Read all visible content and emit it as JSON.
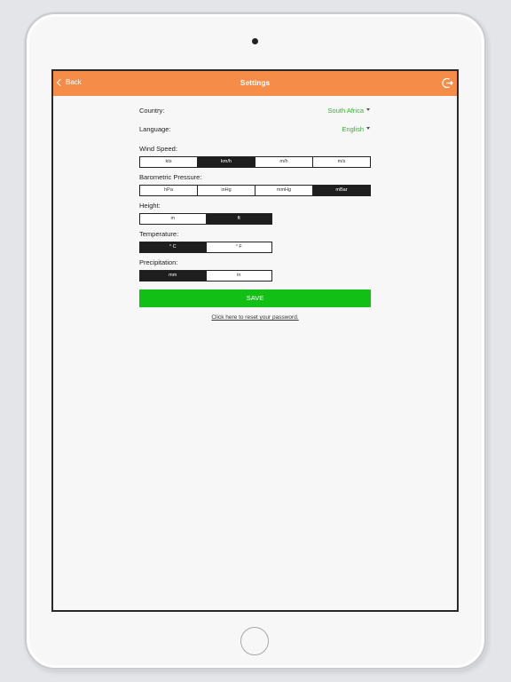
{
  "navbar": {
    "back_label": "Back",
    "title": "Settings",
    "logout_icon": "logout-icon"
  },
  "settings": {
    "country": {
      "label": "Country:",
      "value": "South Africa"
    },
    "language": {
      "label": "Language:",
      "value": "English"
    },
    "wind_speed": {
      "label": "Wind Speed:",
      "options": [
        "kts",
        "km/h",
        "m/h",
        "m/s"
      ],
      "selected": "km/h"
    },
    "pressure": {
      "label": "Barometric Pressure:",
      "options": [
        "hPa",
        "inHg",
        "mmHg",
        "mBar"
      ],
      "selected": "mBar"
    },
    "height": {
      "label": "Height:",
      "options": [
        "m",
        "ft"
      ],
      "selected": "ft"
    },
    "temperature": {
      "label": "Temperature:",
      "options": [
        "° C",
        "° F"
      ],
      "selected": "° C"
    },
    "precipitation": {
      "label": "Precipitation:",
      "options": [
        "mm",
        "in"
      ],
      "selected": "mm"
    }
  },
  "save_label": "SAVE",
  "reset_link": "Click here to reset your password.",
  "colors": {
    "header": "#f58c47",
    "accent_green": "#12bf14",
    "value_green": "#2fb52a"
  }
}
